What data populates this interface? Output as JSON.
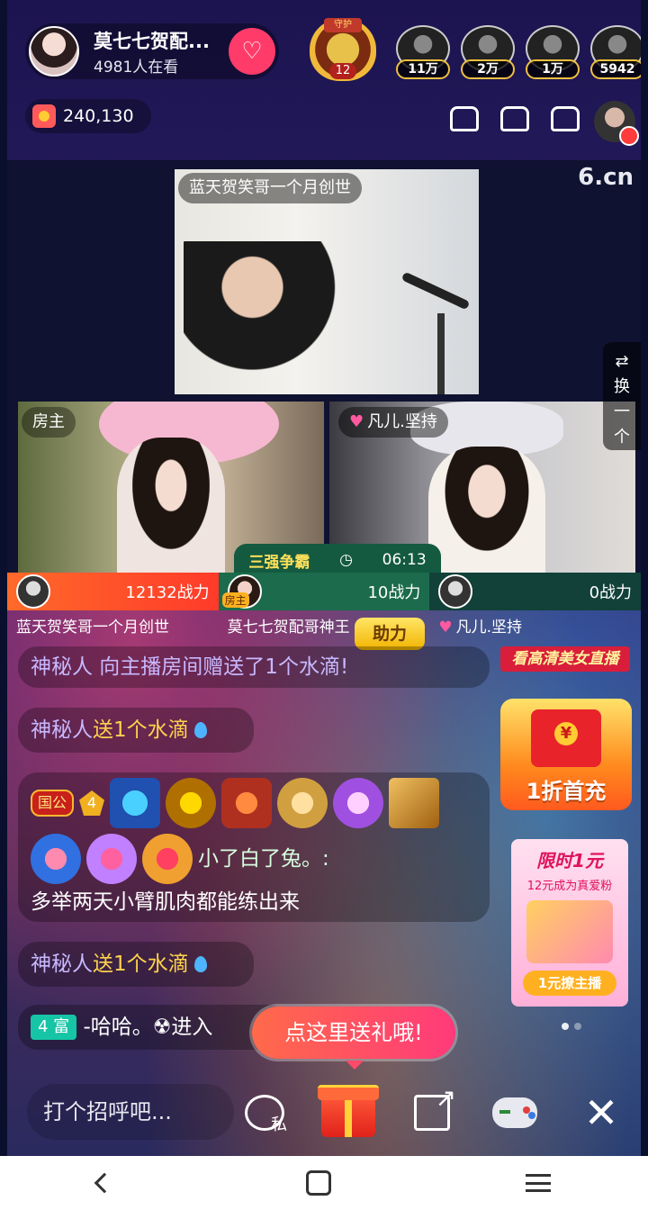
{
  "header": {
    "host_name": "莫七七贺配...",
    "viewers": "4981人在看",
    "follow_icon": "heart-plus-icon",
    "guard_label": "守护",
    "guard_level": "12",
    "top_fans": [
      {
        "count": "11万"
      },
      {
        "count": "2万"
      },
      {
        "count": "1万"
      },
      {
        "count": "5942"
      }
    ],
    "coins": "240,130"
  },
  "video": {
    "watermark": "6.cn",
    "top_label": "蓝天贺笑哥一个月创世",
    "left_label": "房主",
    "right_label": "凡儿.坚持",
    "switch_label": "⇄\n换\n一\n个"
  },
  "battle": {
    "title": "三强争霸",
    "timer": "06:13",
    "players": [
      {
        "score": "12132战力",
        "name": "蓝天贺笑哥一个月创世"
      },
      {
        "score": "10战力",
        "name": "莫七七贺配哥神王",
        "tag": "房主"
      },
      {
        "score": "0战力",
        "name": "凡儿.坚持"
      }
    ],
    "help_label": "助力"
  },
  "chat": {
    "msg1": "神秘人 向主播房间赠送了1个水滴!",
    "msg2_user": "神秘人",
    "msg2_text": "送1个水滴",
    "msg3_noble": "国公",
    "msg3_level": "4",
    "msg3_user": "小了白了兔。:",
    "msg3_text": "多举两天小臂肌肉都能练出来",
    "msg4_user": "神秘人",
    "msg4_text": "送1个水滴",
    "msg5_tag": "4 富",
    "msg5_text": "-哈哈。☢进入"
  },
  "promos": {
    "hd": "看高清美女直播",
    "first_recharge": "1折首充",
    "fan_title": "限时1元",
    "fan_sub": "12元成为真爱粉",
    "fan_btn": "1元撩主播"
  },
  "gift_prompt": "点这里送礼哦!",
  "toolbar": {
    "say_hi": "打个招呼吧...",
    "private_label": "私",
    "close": "✕"
  }
}
